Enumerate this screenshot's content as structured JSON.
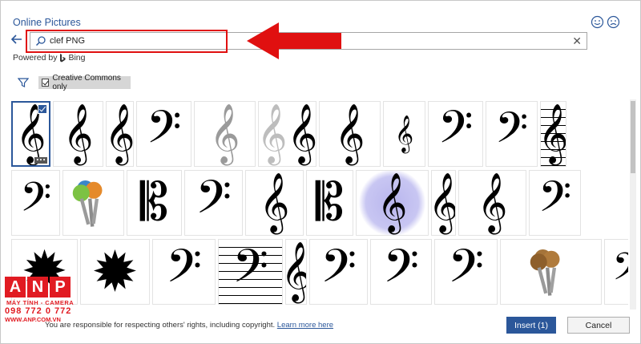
{
  "dialog": {
    "title": "Online Pictures"
  },
  "search": {
    "value": "clef PNG",
    "powered_by": "Powered by",
    "provider": "Bing"
  },
  "filter": {
    "creative_commons_label": "Creative Commons only",
    "checked": true
  },
  "grid": {
    "selected_index": 0,
    "items": [
      {
        "kind": "treble-clef",
        "row": 0
      },
      {
        "kind": "treble-clef",
        "row": 0
      },
      {
        "kind": "treble-clef",
        "row": 0
      },
      {
        "kind": "bass-clef",
        "row": 0
      },
      {
        "kind": "metal-clef",
        "row": 0
      },
      {
        "kind": "treble-clef-pair",
        "row": 0
      },
      {
        "kind": "treble-clef",
        "row": 0
      },
      {
        "kind": "treble-clef-small",
        "row": 0
      },
      {
        "kind": "bass-clef",
        "row": 0
      },
      {
        "kind": "bass-clef",
        "row": 0
      },
      {
        "kind": "treble-clef-staff",
        "row": 0
      },
      {
        "kind": "bass-clef",
        "row": 1
      },
      {
        "kind": "keys-color",
        "row": 1
      },
      {
        "kind": "alto-clef",
        "row": 1
      },
      {
        "kind": "bass-clef",
        "row": 1
      },
      {
        "kind": "treble-clef",
        "row": 1
      },
      {
        "kind": "alto-clef",
        "row": 1
      },
      {
        "kind": "treble-clef-purple",
        "row": 1
      },
      {
        "kind": "treble-clef",
        "row": 1
      },
      {
        "kind": "heart-clef",
        "row": 1
      },
      {
        "kind": "bass-clef",
        "row": 1
      },
      {
        "kind": "star-clef",
        "row": 2
      },
      {
        "kind": "star-clef",
        "row": 2
      },
      {
        "kind": "bass-clef",
        "row": 2
      },
      {
        "kind": "bass-clef-staff",
        "row": 2
      },
      {
        "kind": "treble-clef",
        "row": 2
      },
      {
        "kind": "bass-clef",
        "row": 2
      },
      {
        "kind": "bass-clef",
        "row": 2
      },
      {
        "kind": "bass-clef",
        "row": 2
      },
      {
        "kind": "keys-brass",
        "row": 2
      },
      {
        "kind": "bass-clef",
        "row": 2
      }
    ]
  },
  "footer": {
    "notice": "You are responsible for respecting others' rights, including copyright.",
    "learn_more": "Learn more here",
    "insert_label": "Insert (1)",
    "cancel_label": "Cancel"
  },
  "watermark": {
    "letters": [
      "A",
      "N",
      "P"
    ],
    "line1": "MÁY TÍNH - CAMERA",
    "line2": "098 772 0 772",
    "line3": "WWW.ANP.COM.VN"
  },
  "colors": {
    "accent": "#2b579a",
    "annotation": "#e01010",
    "watermark": "#e11b22"
  }
}
